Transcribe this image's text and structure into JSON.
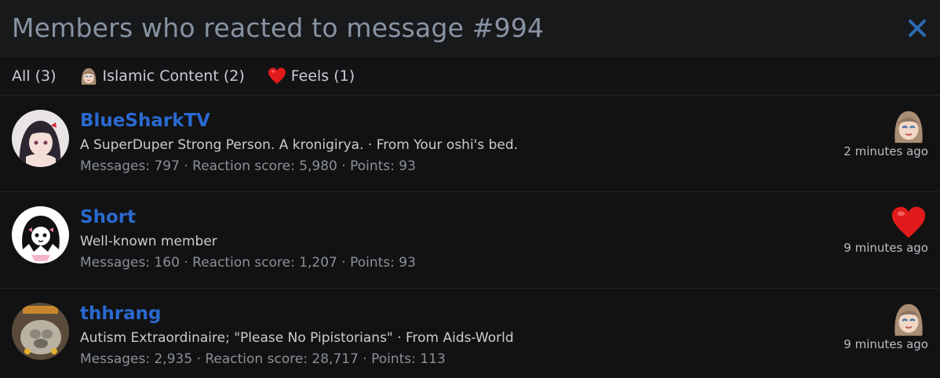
{
  "header": {
    "title": "Members who reacted to message #994"
  },
  "tabs": [
    {
      "label": "All (3)",
      "icon": "none"
    },
    {
      "label": "Islamic Content (2)",
      "icon": "anime-girl-reaction-icon"
    },
    {
      "label": "Feels (1)",
      "icon": "heart-icon"
    }
  ],
  "members": [
    {
      "name": "BlueSharkTV",
      "title": "A SuperDuper Strong Person. A kronigirya. · From Your oshi's bed.",
      "stats": "Messages: 797 · Reaction score: 5,980 · Points: 93",
      "reaction": "anime-girl-reaction-icon",
      "time": "2 minutes ago"
    },
    {
      "name": "Short",
      "title": "Well-known member",
      "stats": "Messages: 160 · Reaction score: 1,207 · Points: 93",
      "reaction": "heart-icon",
      "time": "9 minutes ago"
    },
    {
      "name": "thhrang",
      "title": "Autism Extraordinaire; \"Please No Pipistorians\" · From Aids-World",
      "stats": "Messages: 2,935 · Reaction score: 28,717 · Points: 113",
      "reaction": "anime-girl-reaction-icon",
      "time": "9 minutes ago"
    }
  ],
  "colors": {
    "username": "#2a6ad0",
    "title": "#8794a3",
    "close": "#2b6cb0",
    "heart": "#e11b1b"
  }
}
